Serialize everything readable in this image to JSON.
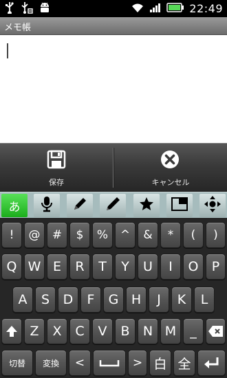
{
  "status_bar": {
    "time": "22:49",
    "icons": [
      "usb-icon",
      "usb-debug-icon",
      "android-icon",
      "wifi-icon",
      "signal-icon",
      "battery-icon"
    ]
  },
  "title_bar": {
    "title": "メモ帳"
  },
  "editor": {
    "text": ""
  },
  "actions": {
    "save_label": "保存",
    "cancel_label": "キャンセル"
  },
  "toolbar": {
    "hiragana_label": "あ",
    "items": [
      "hiragana-mode",
      "mic-icon",
      "pen-icon",
      "pen-fill-icon",
      "star-icon",
      "window-icon",
      "cursor-move-icon"
    ]
  },
  "keyboard": {
    "row1": [
      "!",
      "@",
      "#",
      "$",
      "%",
      "^",
      "&",
      "*",
      "(",
      ")"
    ],
    "row2": [
      "Q",
      "W",
      "E",
      "R",
      "T",
      "Y",
      "U",
      "I",
      "O",
      "P"
    ],
    "row3": [
      "A",
      "S",
      "D",
      "F",
      "G",
      "H",
      "J",
      "K",
      "L"
    ],
    "row4": [
      "Z",
      "X",
      "C",
      "V",
      "B",
      "N",
      "M"
    ],
    "underscore": "_",
    "switch_label": "切替",
    "convert_label": "変換",
    "left_arrow": "<",
    "right_arrow": ">",
    "hankaku_label": "白",
    "zenkaku_label": "全",
    "delete_label": "DEL"
  }
}
